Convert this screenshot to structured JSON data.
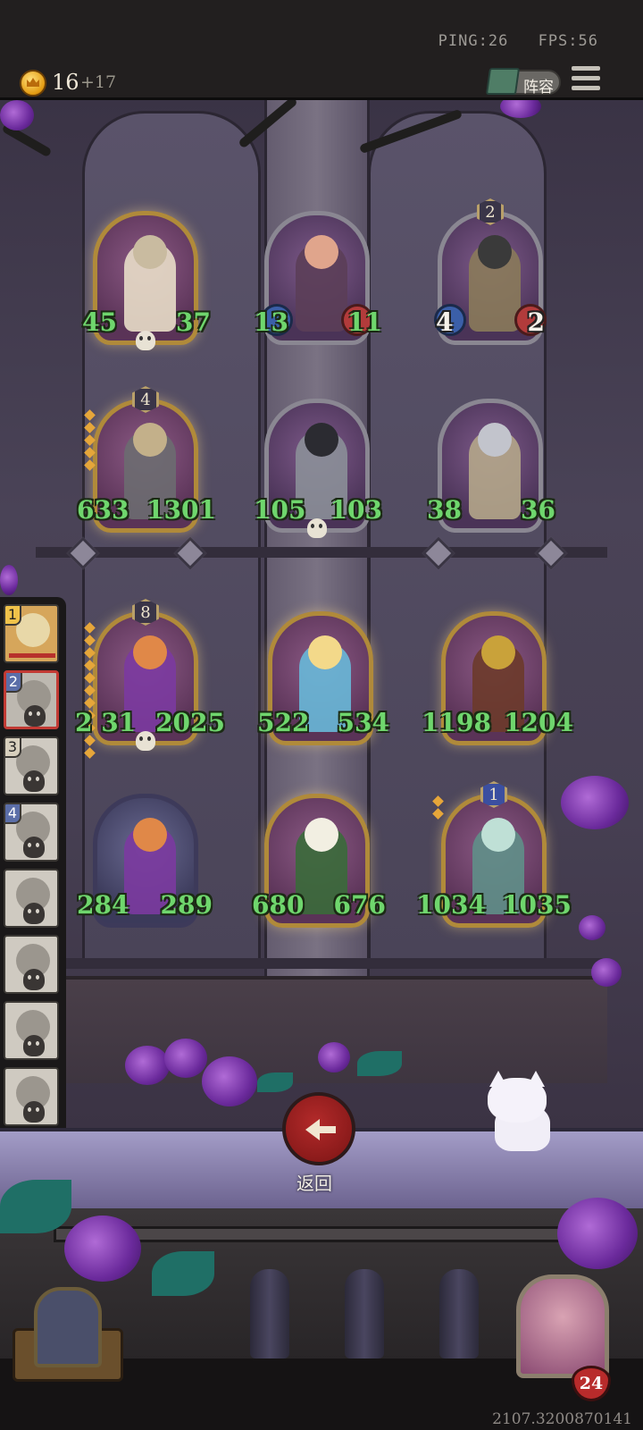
{
  "status": {
    "ping": "PING:26",
    "fps": "FPS:56"
  },
  "currency": {
    "gold": "16",
    "income": "+17"
  },
  "header": {
    "lineup_label": "阵容",
    "menu_icon": "hamburger-menu-icon"
  },
  "board": {
    "units": [
      {
        "slot": "r1c1",
        "atk": "45",
        "hp": "37",
        "frame": "gold",
        "star": "",
        "skull": true
      },
      {
        "slot": "r1c2",
        "atk": "13",
        "hp": "11",
        "frame": "silver",
        "star": ""
      },
      {
        "slot": "r1c3",
        "atk": "4",
        "hp": "2",
        "frame": "gold",
        "star": "2"
      },
      {
        "slot": "r2c1",
        "atk": "633",
        "hp": "1301",
        "frame": "gold",
        "star": "4"
      },
      {
        "slot": "r2c2",
        "atk": "105",
        "hp": "103",
        "frame": "silver",
        "star": "",
        "skull": true
      },
      {
        "slot": "r2c3",
        "atk": "38",
        "hp": "36",
        "frame": "silver",
        "star": ""
      },
      {
        "slot": "r3c1",
        "atk": "2 31",
        "hp": "2025",
        "frame": "gold",
        "star": "8",
        "skull": true
      },
      {
        "slot": "r3c2",
        "atk": "522",
        "hp": "534",
        "frame": "gold",
        "star": ""
      },
      {
        "slot": "r3c3",
        "atk": "1198",
        "hp": "1204",
        "frame": "gold",
        "star": ""
      },
      {
        "slot": "r4c1",
        "atk": "284",
        "hp": "289",
        "frame": "blue",
        "star": ""
      },
      {
        "slot": "r4c2",
        "atk": "680",
        "hp": "676",
        "frame": "gold",
        "star": ""
      },
      {
        "slot": "r4c3",
        "atk": "1034",
        "hp": "1035",
        "frame": "gold",
        "star": "1"
      }
    ]
  },
  "roster": {
    "players": [
      {
        "rank": "1",
        "state": "active"
      },
      {
        "rank": "2",
        "state": "selected"
      },
      {
        "rank": "3",
        "state": "eliminated"
      },
      {
        "rank": "4",
        "state": "eliminated"
      },
      {
        "rank": "",
        "state": "eliminated"
      },
      {
        "rank": "",
        "state": "eliminated"
      },
      {
        "rank": "",
        "state": "eliminated"
      },
      {
        "rank": "",
        "state": "eliminated"
      }
    ]
  },
  "actions": {
    "back_label": "返回",
    "back_icon": "arrow-left-icon"
  },
  "hero": {
    "health": "24"
  },
  "footer": {
    "build_id": "2107.3200870141"
  },
  "colors": {
    "stat_green": "#6fd66d",
    "frame_gold": "#b08a3a",
    "back_red": "#b32a2a",
    "rose_purple": "#6b2a9c"
  }
}
